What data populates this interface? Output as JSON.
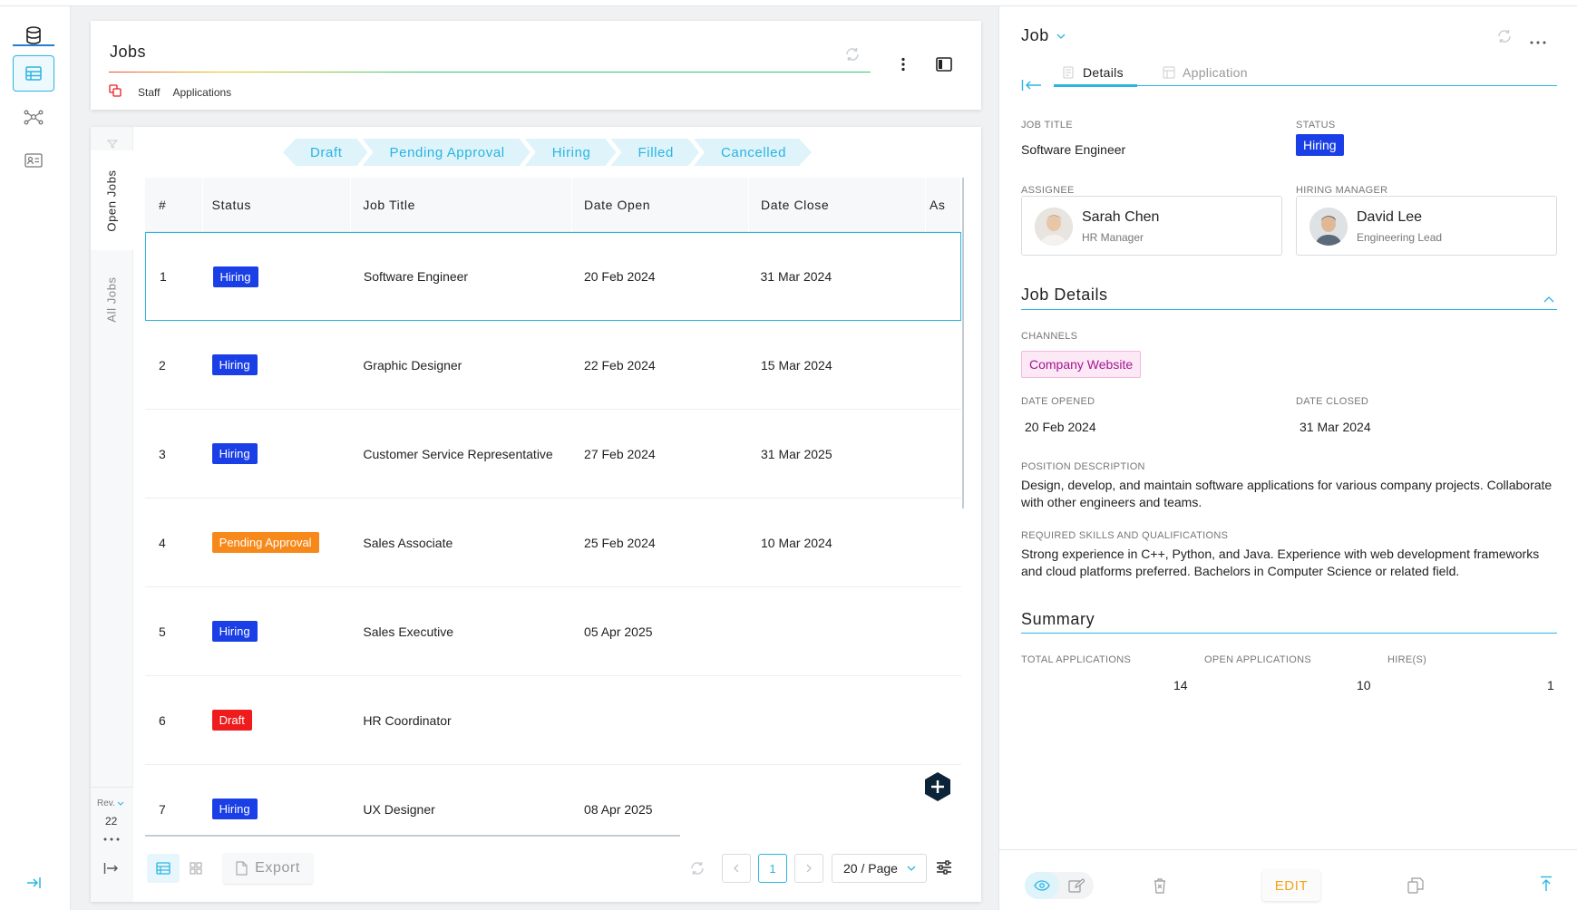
{
  "header": {
    "title": "Jobs",
    "links": [
      "Staff",
      "Applications"
    ]
  },
  "side_tabs": {
    "open_jobs": "Open Jobs",
    "all_jobs": "All Jobs",
    "rev_label": "Rev.",
    "rev_count": "22"
  },
  "status_filters": [
    "Draft",
    "Pending Approval",
    "Hiring",
    "Filled",
    "Cancelled"
  ],
  "table": {
    "columns": [
      "#",
      "Status",
      "Job Title",
      "Date Open",
      "Date Close",
      "As"
    ],
    "rows": [
      {
        "num": "1",
        "status": "Hiring",
        "status_color": "#1b3fe6",
        "title": "Software Engineer",
        "open": "20 Feb 2024",
        "close": "31 Mar 2024"
      },
      {
        "num": "2",
        "status": "Hiring",
        "status_color": "#1b3fe6",
        "title": "Graphic Designer",
        "open": "22 Feb 2024",
        "close": "15 Mar 2024"
      },
      {
        "num": "3",
        "status": "Hiring",
        "status_color": "#1b3fe6",
        "title": "Customer Service Representative",
        "open": "27 Feb 2024",
        "close": "31 Mar 2025"
      },
      {
        "num": "4",
        "status": "Pending Approval",
        "status_color": "#f7891b",
        "title": "Sales Associate",
        "open": "25 Feb 2024",
        "close": "10 Mar 2024"
      },
      {
        "num": "5",
        "status": "Hiring",
        "status_color": "#1b3fe6",
        "title": "Sales Executive",
        "open": "05 Apr 2025",
        "close": ""
      },
      {
        "num": "6",
        "status": "Draft",
        "status_color": "#ee1c1c",
        "title": "HR Coordinator",
        "open": "",
        "close": ""
      },
      {
        "num": "7",
        "status": "Hiring",
        "status_color": "#1b3fe6",
        "title": "UX Designer",
        "open": "08 Apr 2025",
        "close": ""
      }
    ]
  },
  "footer": {
    "export_label": "Export",
    "current_page": "1",
    "page_size": "20 / Page"
  },
  "detail": {
    "title": "Job",
    "tabs": [
      "Details",
      "Application"
    ],
    "job_title_label": "JOB TITLE",
    "job_title": "Software Engineer",
    "status_label": "STATUS",
    "status": "Hiring",
    "assignee_label": "ASSIGNEE",
    "assignee_name": "Sarah Chen",
    "assignee_role": "HR Manager",
    "manager_label": "HIRING MANAGER",
    "manager_name": "David Lee",
    "manager_role": "Engineering Lead",
    "job_details_title": "Job Details",
    "channels_label": "CHANNELS",
    "channel": "Company Website",
    "date_opened_label": "DATE OPENED",
    "date_opened": "20 Feb 2024",
    "date_closed_label": "DATE CLOSED",
    "date_closed": "31 Mar 2024",
    "position_desc_label": "POSITION DESCRIPTION",
    "position_desc": "Design, develop, and maintain software applications for various company projects. Collaborate with other engineers and teams.",
    "skills_label": "REQUIRED SKILLS AND QUALIFICATIONS",
    "skills": "Strong experience in C++, Python, and Java. Experience with web development frameworks and cloud platforms preferred. Bachelors in Computer Science or related field.",
    "summary_title": "Summary",
    "total_apps_label": "TOTAL APPLICATIONS",
    "total_apps": "14",
    "open_apps_label": "OPEN APPLICATIONS",
    "open_apps": "10",
    "hires_label": "HIRE(S)",
    "hires": "1",
    "edit_label": "EDIT"
  },
  "colors": {
    "accent": "#29b5e0",
    "hiring": "#1b3fe6",
    "pending": "#f7891b",
    "draft": "#ee1c1c",
    "edit": "#f6a21a"
  }
}
